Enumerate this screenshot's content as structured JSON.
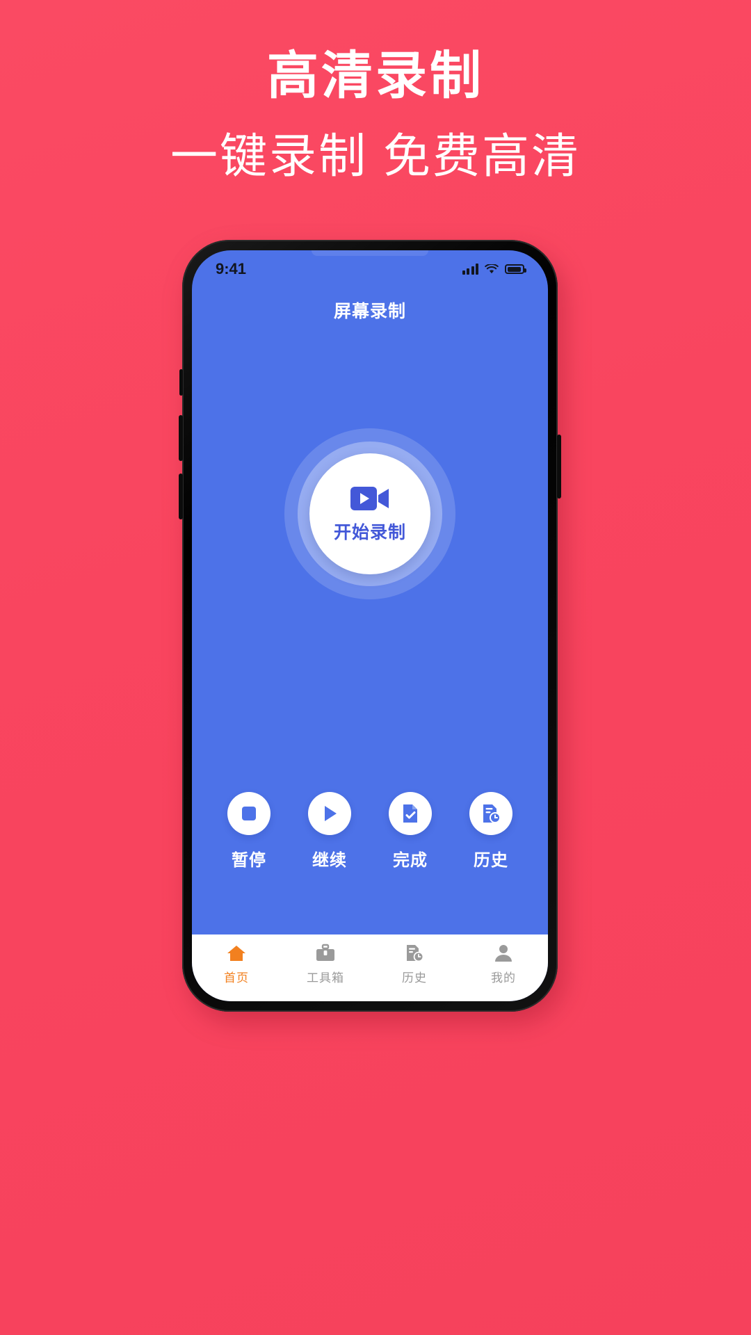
{
  "promo": {
    "title": "高清录制",
    "subtitle": "一键录制 免费高清",
    "bg_color": "#f9455f",
    "text_color": "#ffffff"
  },
  "phone": {
    "status_bar": {
      "time": "9:41",
      "signal_icon": "signal-bars-icon",
      "wifi_icon": "wifi-icon",
      "battery_icon": "battery-icon"
    },
    "app": {
      "header_title": "屏幕录制",
      "accent_color": "#4d72e8",
      "record_button": {
        "label": "开始录制",
        "icon": "video-camera-icon",
        "label_color": "#4358d8"
      },
      "actions": [
        {
          "label": "暂停",
          "icon": "stop-square-icon"
        },
        {
          "label": "继续",
          "icon": "play-triangle-icon"
        },
        {
          "label": "完成",
          "icon": "document-check-icon"
        },
        {
          "label": "历史",
          "icon": "document-clock-icon"
        }
      ],
      "tabs": [
        {
          "label": "首页",
          "icon": "home-icon",
          "active": true
        },
        {
          "label": "工具箱",
          "icon": "toolbox-icon",
          "active": false
        },
        {
          "label": "历史",
          "icon": "document-clock-icon",
          "active": false
        },
        {
          "label": "我的",
          "icon": "person-icon",
          "active": false
        }
      ],
      "tab_active_color": "#f2801f",
      "tab_inactive_color": "#9a9a9a"
    }
  }
}
